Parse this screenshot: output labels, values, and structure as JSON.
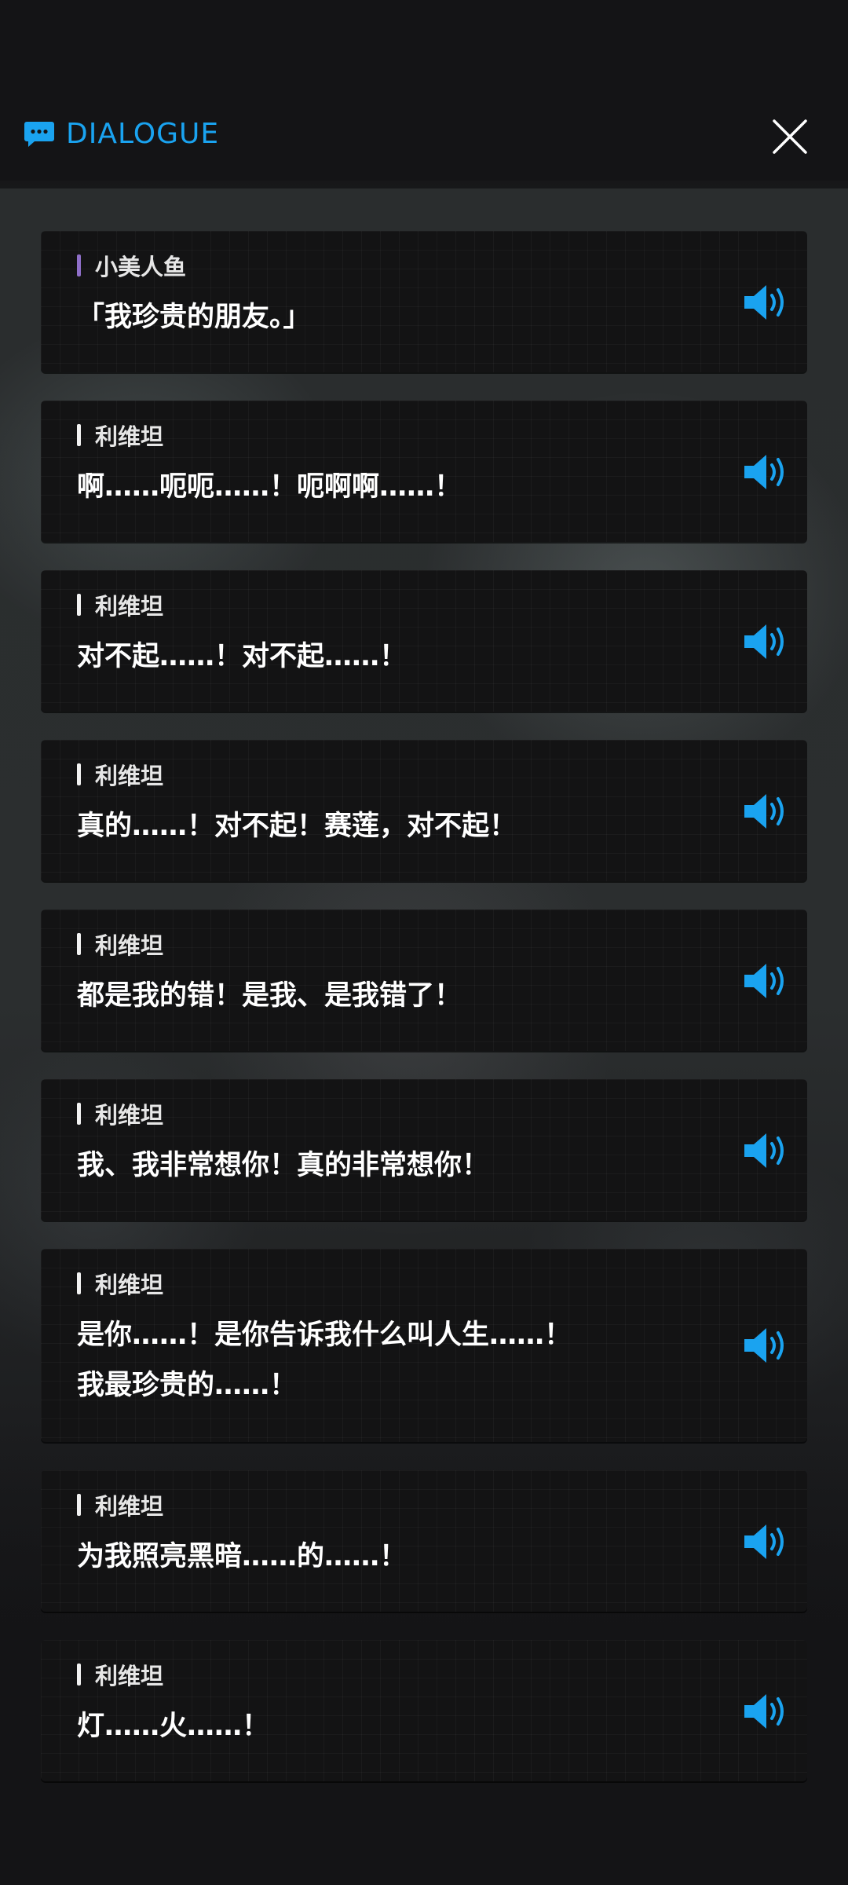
{
  "header": {
    "title": "DIALOGUE",
    "icon": "chat-bubble-icon",
    "close_icon": "close-icon",
    "accent": "#1aa3f0"
  },
  "dialogue": [
    {
      "speaker": "小美人鱼",
      "speaker_color": "#8f6fc9",
      "lines": [
        "「我珍贵的朋友。」"
      ]
    },
    {
      "speaker": "利维坦",
      "speaker_color": "#f2f2f2",
      "lines": [
        "啊……呃呃……！呃啊啊……！"
      ]
    },
    {
      "speaker": "利维坦",
      "speaker_color": "#f2f2f2",
      "lines": [
        "对不起……！对不起……！"
      ]
    },
    {
      "speaker": "利维坦",
      "speaker_color": "#f2f2f2",
      "lines": [
        "真的……！对不起！赛莲，对不起！"
      ]
    },
    {
      "speaker": "利维坦",
      "speaker_color": "#f2f2f2",
      "lines": [
        "都是我的错！是我、是我错了！"
      ]
    },
    {
      "speaker": "利维坦",
      "speaker_color": "#f2f2f2",
      "lines": [
        "我、我非常想你！真的非常想你！"
      ]
    },
    {
      "speaker": "利维坦",
      "speaker_color": "#f2f2f2",
      "lines": [
        "是你……！是你告诉我什么叫人生……！",
        "我最珍贵的……！"
      ]
    },
    {
      "speaker": "利维坦",
      "speaker_color": "#f2f2f2",
      "lines": [
        "为我照亮黑暗……的……！"
      ]
    },
    {
      "speaker": "利维坦",
      "speaker_color": "#f2f2f2",
      "lines": [
        "灯……火……！"
      ]
    }
  ],
  "voice_icon": "speaker-volume-icon",
  "voice_color": "#1aa3f0"
}
